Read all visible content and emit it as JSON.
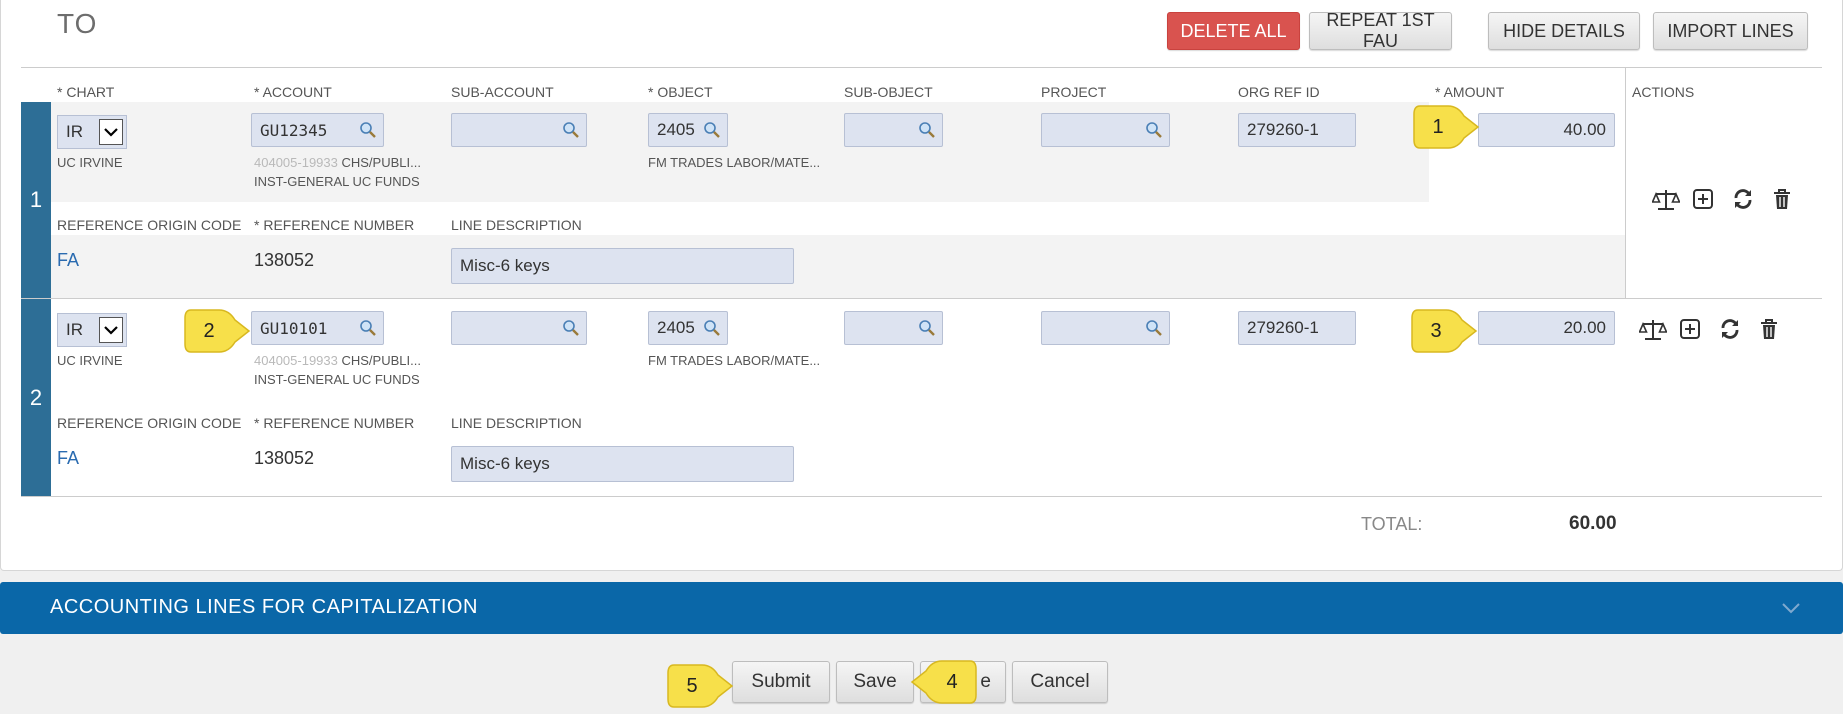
{
  "section": {
    "title": "TO"
  },
  "toolbar": {
    "delete_all": "DELETE ALL",
    "repeat_first_fau": "REPEAT 1ST FAU",
    "hide_details": "HIDE DETAILS",
    "import_lines": "IMPORT LINES"
  },
  "columns": {
    "required_marker": "*",
    "chart": "CHART",
    "account": "ACCOUNT",
    "sub_account": "SUB-ACCOUNT",
    "object": "OBJECT",
    "sub_object": "SUB-OBJECT",
    "project": "PROJECT",
    "org_ref_id": "ORG REF ID",
    "amount": "AMOUNT",
    "actions": "ACTIONS"
  },
  "detail_labels": {
    "reference_origin_code": "REFERENCE ORIGIN CODE",
    "reference_number": "REFERENCE NUMBER",
    "line_description": "LINE DESCRIPTION"
  },
  "lines": [
    {
      "number": "1",
      "chart": "IR",
      "chart_name": "UC IRVINE",
      "account": "GU12345",
      "account_code": "404005-19933",
      "account_name": "CHS/PUBLI...",
      "account_fund": "INST-GENERAL UC FUNDS",
      "sub_account": "",
      "object": "2405",
      "object_name": "FM TRADES LABOR/MATE...",
      "sub_object": "",
      "project": "",
      "org_ref_id": "279260-1",
      "amount": "40.00",
      "reference_origin_code": "FA",
      "reference_number": "138052",
      "line_description": "Misc-6 keys"
    },
    {
      "number": "2",
      "chart": "IR",
      "chart_name": "UC IRVINE",
      "account": "GU10101",
      "account_code": "404005-19933",
      "account_name": "CHS/PUBLI...",
      "account_fund": "INST-GENERAL UC FUNDS",
      "sub_account": "",
      "object": "2405",
      "object_name": "FM TRADES LABOR/MATE...",
      "sub_object": "",
      "project": "",
      "org_ref_id": "279260-1",
      "amount": "20.00",
      "reference_origin_code": "FA",
      "reference_number": "138052",
      "line_description": "Misc-6 keys"
    }
  ],
  "totals": {
    "label": "TOTAL:",
    "value": "60.00"
  },
  "capitalization": {
    "title": "ACCOUNTING LINES FOR CAPITALIZATION"
  },
  "footer": {
    "submit": "Submit",
    "save": "Save",
    "hidden_button": "e",
    "cancel": "Cancel"
  },
  "callouts": [
    "1",
    "2",
    "3",
    "4",
    "5"
  ],
  "colors": {
    "accent": "#2d6e96",
    "danger": "#d9534f",
    "bar": "#0a67a8",
    "callout": "#f7e04a"
  },
  "icons": [
    "search-icon",
    "chevron-down-icon",
    "balance-icon",
    "plus-box-icon",
    "refresh-icon",
    "trash-icon"
  ]
}
